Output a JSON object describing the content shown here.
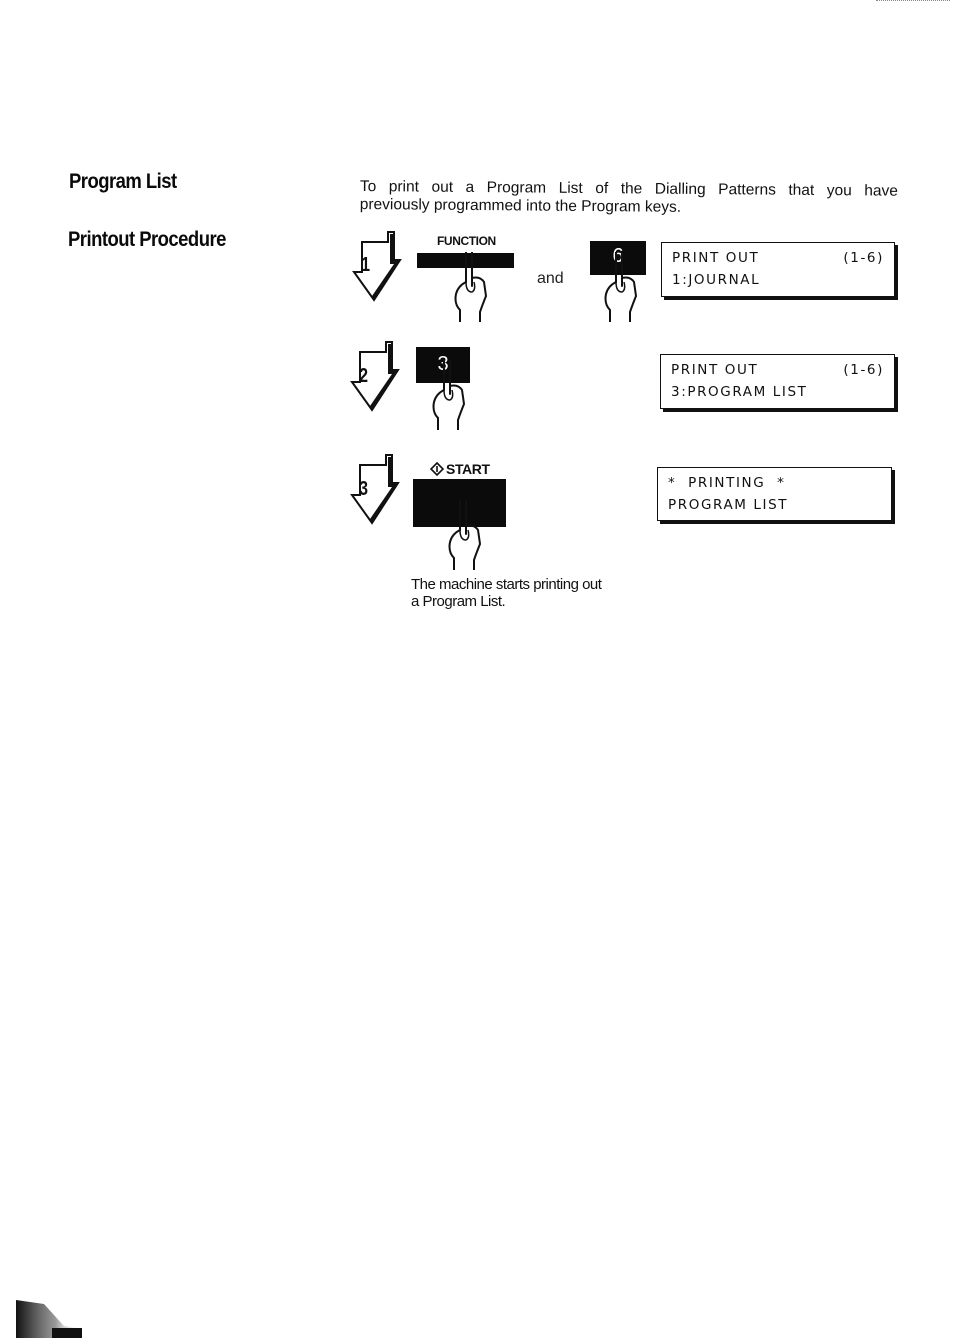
{
  "section": {
    "title": "Program List",
    "subtitle": "Printout Procedure"
  },
  "intro": {
    "line1": "To print out a Program List of the Dialling Patterns that you have",
    "line2": "previously programmed into the Program keys."
  },
  "steps": [
    {
      "number": "1",
      "keys": [
        {
          "label": "FUNCTION",
          "face": "",
          "icon": "hand-press-icon"
        },
        {
          "label": "",
          "face": "6",
          "icon": "hand-press-icon"
        }
      ],
      "connector": "and",
      "display": {
        "line1_left": "PRINT OUT",
        "line1_right": "(1-6)",
        "line2": "1:JOURNAL"
      }
    },
    {
      "number": "2",
      "keys": [
        {
          "label": "",
          "face": "3",
          "icon": "hand-press-icon"
        }
      ],
      "display": {
        "line1_left": "PRINT OUT",
        "line1_right": "(1-6)",
        "line2": "3:PROGRAM LIST"
      }
    },
    {
      "number": "3",
      "keys": [
        {
          "label": "START",
          "face": "",
          "icon": "start-diamond-icon"
        }
      ],
      "display": {
        "line1_left": "*  PRINTING  *",
        "line1_right": "",
        "line2": "PROGRAM LIST"
      },
      "note": {
        "line1": "The machine starts printing out",
        "line2": "a Program List."
      }
    }
  ],
  "colors": {
    "ink": "#0b0b0b",
    "paper": "#ffffff"
  }
}
